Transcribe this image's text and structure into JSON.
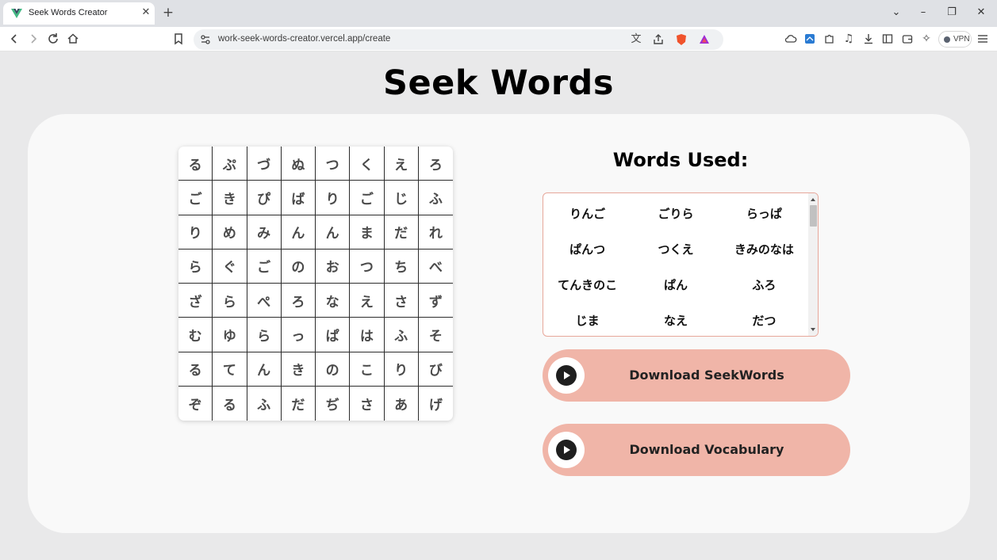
{
  "browser": {
    "tab_title": "Seek Words Creator",
    "url": "work-seek-words-creator.vercel.app/create",
    "vpn_label": "VPN",
    "accent_color": "#42b883"
  },
  "page": {
    "title": "Seek Words"
  },
  "grid": [
    [
      "る",
      "ぷ",
      "づ",
      "ぬ",
      "つ",
      "く",
      "え",
      "ろ"
    ],
    [
      "ご",
      "き",
      "ぴ",
      "ば",
      "り",
      "ご",
      "じ",
      "ふ"
    ],
    [
      "り",
      "め",
      "み",
      "ん",
      "ん",
      "ま",
      "だ",
      "れ"
    ],
    [
      "ら",
      "ぐ",
      "ご",
      "の",
      "お",
      "つ",
      "ち",
      "べ"
    ],
    [
      "ざ",
      "ら",
      "ぺ",
      "ろ",
      "な",
      "え",
      "さ",
      "ず"
    ],
    [
      "む",
      "ゆ",
      "ら",
      "っ",
      "ぱ",
      "は",
      "ふ",
      "そ"
    ],
    [
      "る",
      "て",
      "ん",
      "き",
      "の",
      "こ",
      "り",
      "び"
    ],
    [
      "ぞ",
      "る",
      "ふ",
      "だ",
      "ぢ",
      "さ",
      "あ",
      "げ"
    ]
  ],
  "words_used": {
    "title": "Words Used:",
    "items": [
      "りんご",
      "ごりら",
      "らっぱ",
      "ぱんつ",
      "つくえ",
      "きみのなは",
      "てんきのこ",
      "ぱん",
      "ふろ",
      "じま",
      "なえ",
      "だつ"
    ]
  },
  "buttons": {
    "download_seekwords": "Download SeekWords",
    "download_vocabulary": "Download Vocabulary"
  },
  "colors": {
    "button_bg": "#f0b5a8",
    "box_border": "#e7a79a",
    "card_bg": "#f9f9f9",
    "page_bg": "#e9e9ea"
  }
}
